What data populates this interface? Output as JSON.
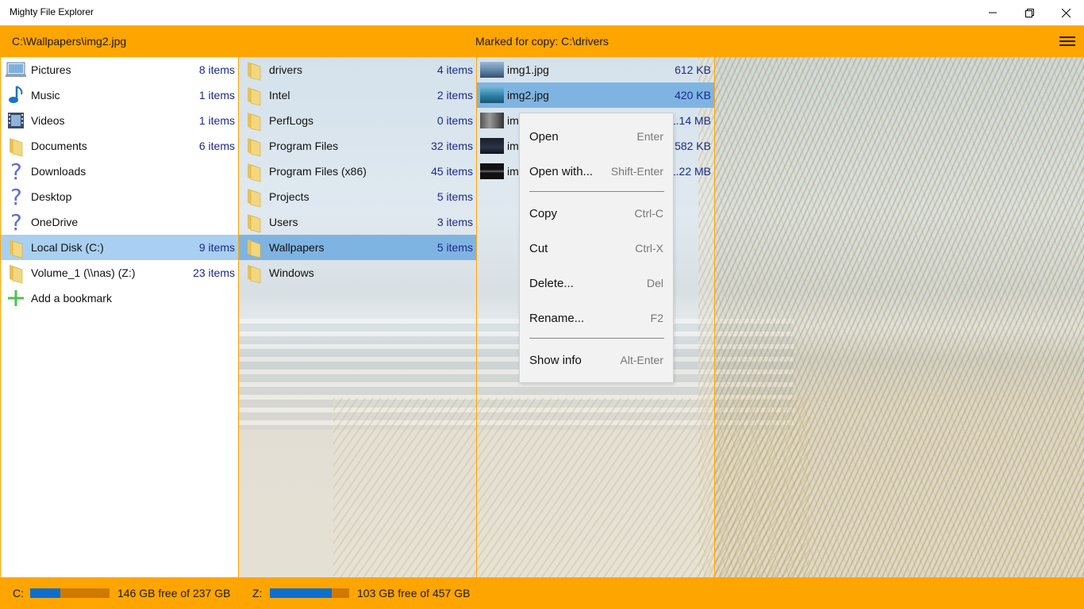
{
  "app": {
    "title": "Mighty File Explorer"
  },
  "pathbar": {
    "path": "C:\\Wallpapers\\img2.jpg",
    "marked": "Marked for copy: C:\\drivers"
  },
  "bookmarks": [
    {
      "label": "Pictures",
      "count": "8 items",
      "icon": "pictures-icon"
    },
    {
      "label": "Music",
      "count": "1 items",
      "icon": "music-icon"
    },
    {
      "label": "Videos",
      "count": "1 items",
      "icon": "videos-icon"
    },
    {
      "label": "Documents",
      "count": "6 items",
      "icon": "folder-icon"
    },
    {
      "label": "Downloads",
      "count": "",
      "icon": "question-icon"
    },
    {
      "label": "Desktop",
      "count": "",
      "icon": "question-icon"
    },
    {
      "label": "OneDrive",
      "count": "",
      "icon": "question-icon"
    },
    {
      "label": "Local Disk (C:)",
      "count": "9 items",
      "icon": "folder-icon"
    },
    {
      "label": "Volume_1 (\\\\nas) (Z:)",
      "count": "23 items",
      "icon": "folder-icon"
    },
    {
      "label": "Add a bookmark",
      "count": "",
      "icon": "plus-icon"
    }
  ],
  "folders": [
    {
      "label": "drivers",
      "count": "4 items"
    },
    {
      "label": "Intel",
      "count": "2 items"
    },
    {
      "label": "PerfLogs",
      "count": "0 items"
    },
    {
      "label": "Program Files",
      "count": "32 items"
    },
    {
      "label": "Program Files (x86)",
      "count": "45 items"
    },
    {
      "label": "Projects",
      "count": "5 items"
    },
    {
      "label": "Users",
      "count": "3 items"
    },
    {
      "label": "Wallpapers",
      "count": "5 items"
    },
    {
      "label": "Windows",
      "count": ""
    }
  ],
  "files": [
    {
      "label": "img1.jpg",
      "size": "612 KB"
    },
    {
      "label": "img2.jpg",
      "size": "420 KB"
    },
    {
      "label": "im",
      "size": "1.14 MB"
    },
    {
      "label": "im",
      "size": "582 KB"
    },
    {
      "label": "im",
      "size": "1.22 MB"
    }
  ],
  "context_menu": {
    "open": {
      "label": "Open",
      "key": "Enter"
    },
    "open_with": {
      "label": "Open with...",
      "key": "Shift-Enter"
    },
    "copy": {
      "label": "Copy",
      "key": "Ctrl-C"
    },
    "cut": {
      "label": "Cut",
      "key": "Ctrl-X"
    },
    "delete": {
      "label": "Delete...",
      "key": "Del"
    },
    "rename": {
      "label": "Rename...",
      "key": "F2"
    },
    "show_info": {
      "label": "Show info",
      "key": "Alt-Enter"
    }
  },
  "status": {
    "c": {
      "drive": "C:",
      "free": "146 GB free of 237 GB",
      "used_fraction": 0.38
    },
    "z": {
      "drive": "Z:",
      "free": "103 GB free of 457 GB",
      "used_fraction": 0.78
    }
  },
  "colors": {
    "accent": "#ffa500",
    "selection_light": "#a9d0f0",
    "selection": "#7fb4e2",
    "count_text": "#1a2a8a",
    "drive_bar_fill": "#0a6fd1"
  }
}
